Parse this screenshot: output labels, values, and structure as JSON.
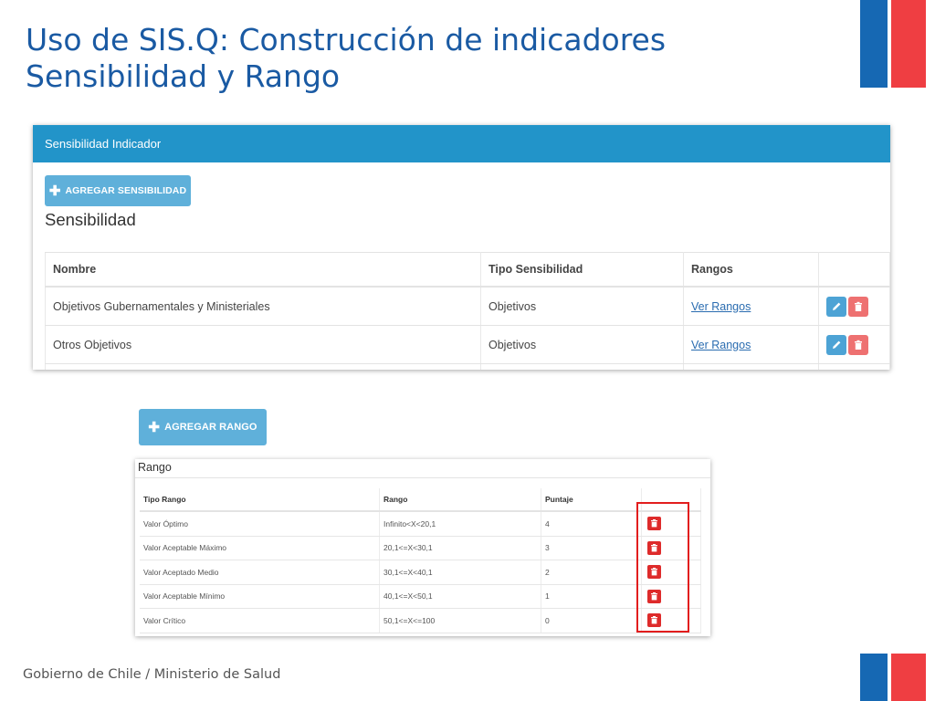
{
  "slide": {
    "title_line1": "Uso de SIS.Q: Construcción de indicadores",
    "title_line2": "Sensibilidad y Rango",
    "footer": "Gobierno de Chile / Ministerio de Salud"
  },
  "colors": {
    "title": "#1a5aa3",
    "header": "#2294c9",
    "button": "#5fb0da",
    "flag_blue": "#1668b3",
    "flag_red": "#ef3e42",
    "highlight": "#e21d1d"
  },
  "sensibilidad_panel": {
    "header": "Sensibilidad Indicador",
    "add_button": "AGREGAR SENSIBILIDAD",
    "section_title": "Sensibilidad",
    "columns": [
      "Nombre",
      "Tipo Sensibilidad",
      "Rangos",
      ""
    ],
    "rows": [
      {
        "nombre": "Objetivos Gubernamentales y Ministeriales",
        "tipo": "Objetivos",
        "rangos_link": "Ver Rangos",
        "edit_icon": "pencil-icon",
        "delete_icon": "trash-icon"
      },
      {
        "nombre": "Otros Objetivos",
        "tipo": "Objetivos",
        "rangos_link": "Ver Rangos",
        "edit_icon": "pencil-icon",
        "delete_icon": "trash-icon"
      }
    ]
  },
  "rango_panel": {
    "add_button": "AGREGAR RANGO",
    "title": "Rango",
    "columns": [
      "Tipo Rango",
      "Rango",
      "Puntaje",
      ""
    ],
    "rows": [
      {
        "tipo": "Valor Óptimo",
        "rango": "Infinito<X<20,1",
        "puntaje": "4"
      },
      {
        "tipo": "Valor Aceptable Máximo",
        "rango": "20,1<=X<30,1",
        "puntaje": "3"
      },
      {
        "tipo": "Valor Aceptado Medio",
        "rango": "30,1<=X<40,1",
        "puntaje": "2"
      },
      {
        "tipo": "Valor Aceptable Mínimo",
        "rango": "40,1<=X<50,1",
        "puntaje": "1"
      },
      {
        "tipo": "Valor Crítico",
        "rango": "50,1<=X<=100",
        "puntaje": "0"
      }
    ]
  }
}
